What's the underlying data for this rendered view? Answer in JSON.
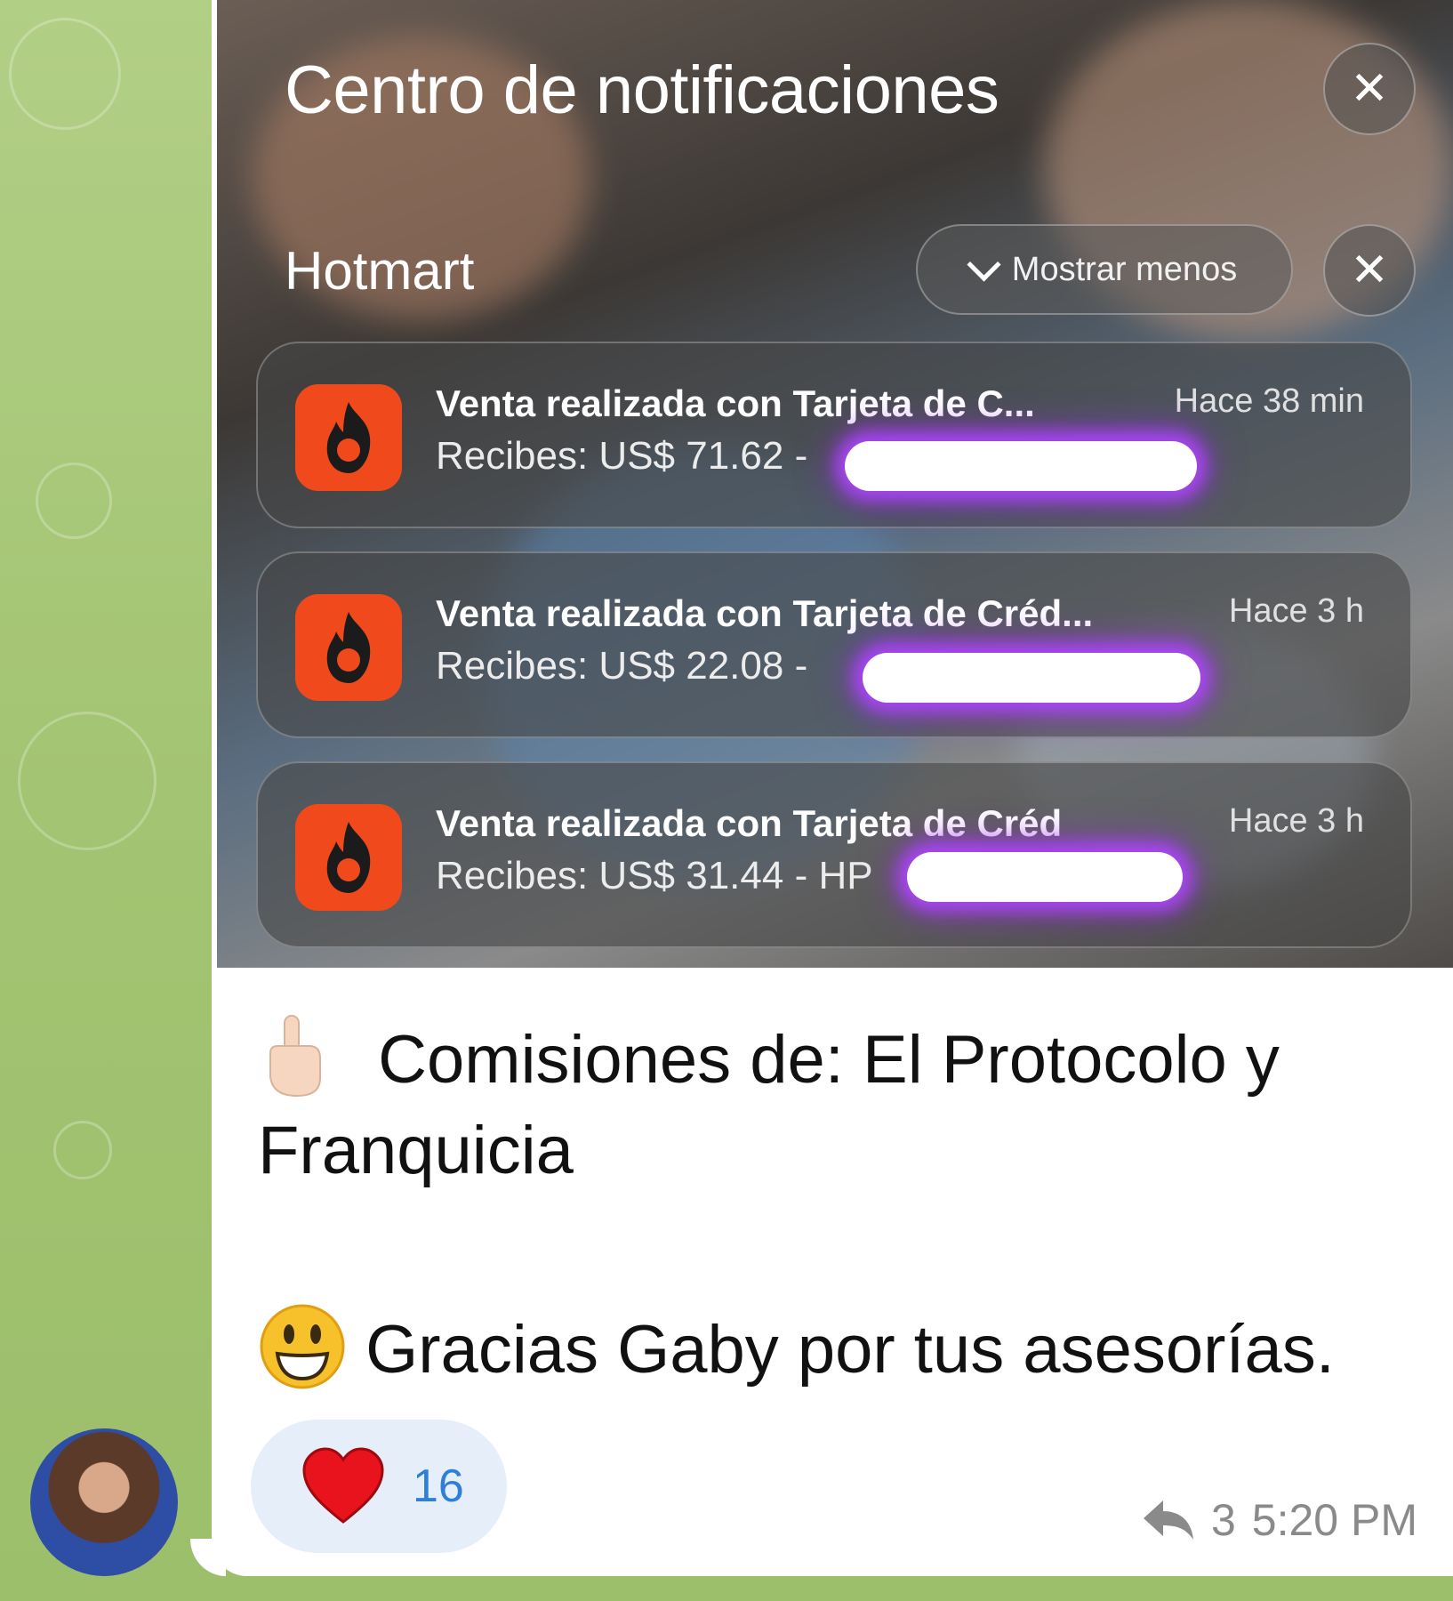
{
  "notification_center": {
    "title": "Centro de notificaciones",
    "close_icon": "close-icon",
    "group": {
      "name": "Hotmart",
      "show_less_label": "Mostrar menos",
      "items": [
        {
          "title": "Venta realizada con Tarjeta de C...",
          "body": "Recibes: US$ 71.62 -",
          "time": "Hace 38 min"
        },
        {
          "title": "Venta realizada con Tarjeta de Créd...",
          "body": "Recibes: US$ 22.08 -",
          "time": "Hace 3 h"
        },
        {
          "title": "Venta realizada con Tarjeta de Créd",
          "body": "Recibes: US$ 31.44 - HP",
          "time": "Hace 3 h"
        }
      ]
    }
  },
  "message": {
    "line1_text": "Comisiones de: El Protocolo y",
    "line2_text": "Franquicia",
    "line3_text": "Gracias Gaby por tus asesorías.",
    "reaction_count": "16",
    "reply_count": "3",
    "time": "5:20 PM"
  },
  "colors": {
    "hotmart_orange": "#f04a1c",
    "reaction_blue": "#2f7fd8",
    "chat_bg": "#a9c97a"
  }
}
